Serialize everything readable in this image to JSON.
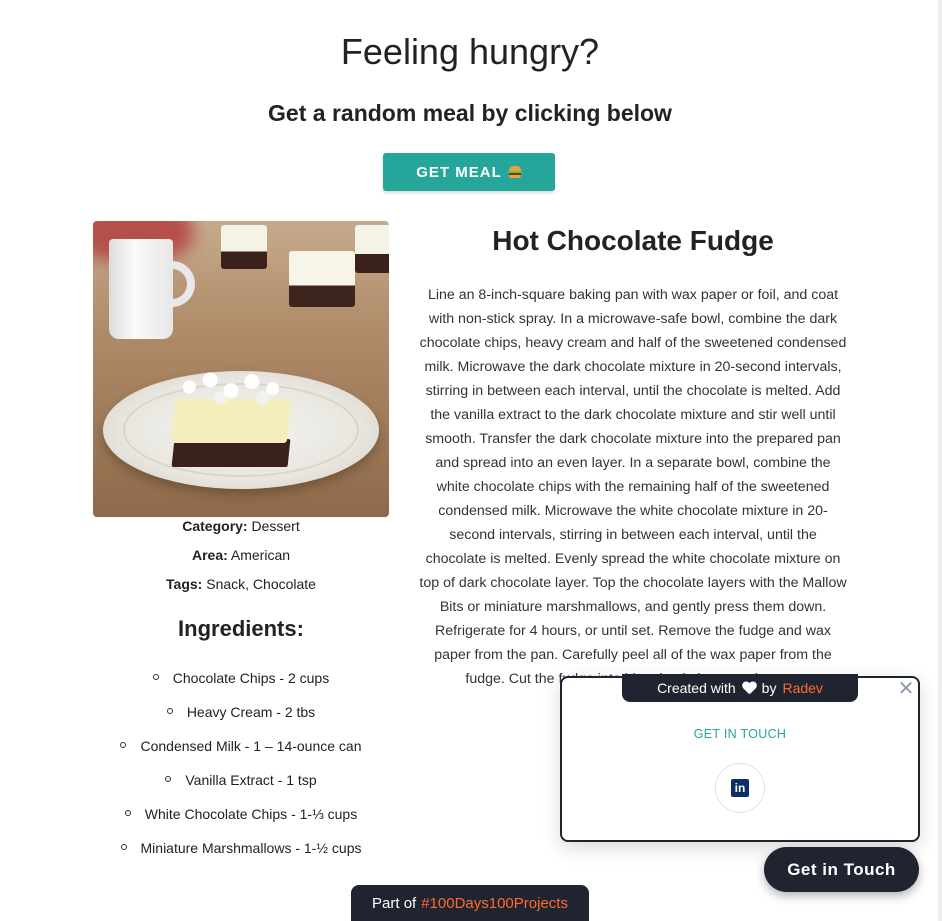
{
  "header": {
    "title": "Feeling hungry?",
    "subtitle": "Get a random meal by clicking below",
    "button_label": "GET MEAL",
    "button_icon": "hamburger-icon"
  },
  "meal": {
    "name": "Hot Chocolate Fudge",
    "category_label": "Category:",
    "category": "Dessert",
    "area_label": "Area:",
    "area": "American",
    "tags_label": "Tags:",
    "tags": "Snack, Chocolate",
    "ingredients_title": "Ingredients:",
    "ingredients": [
      "Chocolate Chips - 2 cups",
      "Heavy Cream - 2 tbs",
      "Condensed Milk - 1 – 14-ounce can",
      "Vanilla Extract - 1 tsp",
      "White Chocolate Chips - 1-⅓ cups",
      "Miniature Marshmallows - 1-½ cups"
    ],
    "instructions": "Line an 8-inch-square baking pan with wax paper or foil, and coat with non-stick spray. In a microwave-safe bowl, combine the dark chocolate chips, heavy cream and half of the sweetened condensed milk. Microwave the dark chocolate mixture in 20-second intervals, stirring in between each interval, until the chocolate is melted. Add the vanilla extract to the dark chocolate mixture and stir well until smooth. Transfer the dark chocolate mixture into the prepared pan and spread into an even layer. In a separate bowl, combine the white chocolate chips with the remaining half of the sweetened condensed milk. Microwave the white chocolate mixture in 20-second intervals, stirring in between each interval, until the chocolate is melted. Evenly spread the white chocolate mixture on top of dark chocolate layer. Top the chocolate layers with the Mallow Bits or miniature marshmallows, and gently press them down. Refrigerate for 4 hours, or until set. Remove the fudge and wax paper from the pan. Carefully peel all of the wax paper from the fudge. Cut the fudge into bite-sized pieces and serve."
  },
  "popup": {
    "created_with": "Created with",
    "by": "by",
    "author": "Radev",
    "close_icon": "close-icon",
    "get_in_touch_link": "GET IN TOUCH",
    "social_icon": "linkedin-icon"
  },
  "floating_button": {
    "label": "Get in Touch"
  },
  "footer_badge": {
    "prefix": "Part of",
    "hashtag": "#100Days100Projects"
  },
  "colors": {
    "accent": "#26a69a",
    "dark": "#1f2430",
    "highlight": "#ff6a2b"
  }
}
